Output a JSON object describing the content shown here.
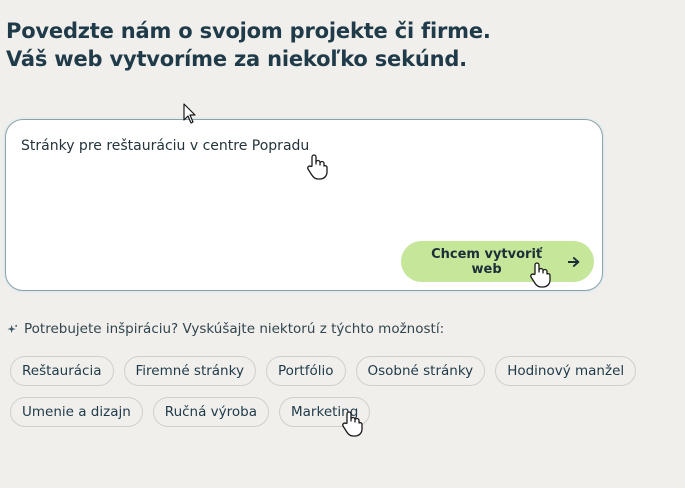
{
  "headline": {
    "line1": "Povedzte nám o svojom projekte či firme.",
    "line2": "Váš web vytvoríme za niekoľko sekúnd."
  },
  "prompt": {
    "value": "Stránky pre reštauráciu v centre Popradu"
  },
  "create_button": {
    "label": "Chcem vytvoriť web",
    "icon": "arrow-right-icon",
    "color": "#c6e79a"
  },
  "inspiration": {
    "icon": "sparkle-icon",
    "text": "Potrebujete inšpiráciu? Vyskúšajte niektorú z týchto možností:"
  },
  "suggestions": [
    "Reštaurácia",
    "Firemné stránky",
    "Portfólio",
    "Osobné stránky",
    "Hodinový manžel",
    "Umenie a dizajn",
    "Ručná výroba",
    "Marketing"
  ],
  "colors": {
    "background": "#f0efec",
    "text": "#1f3a48",
    "accent": "#c6e79a"
  }
}
